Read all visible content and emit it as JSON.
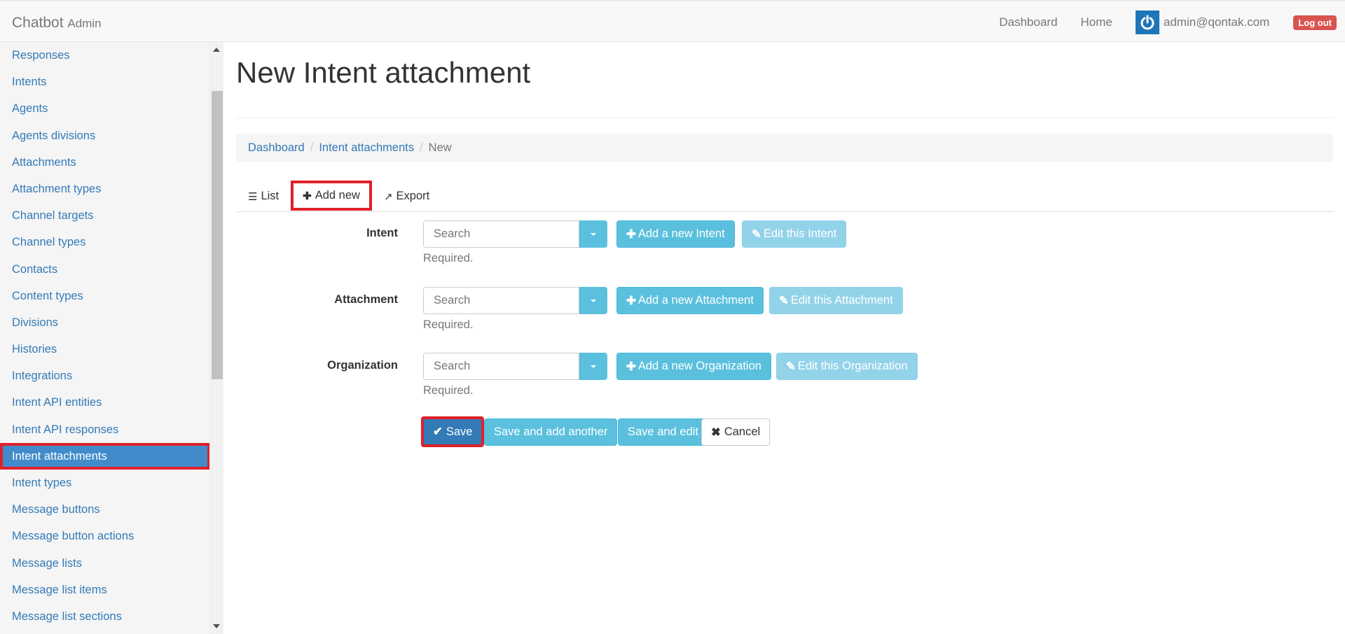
{
  "navbar": {
    "brand": "Chatbot",
    "brand_suffix": "Admin",
    "links": [
      "Dashboard",
      "Home"
    ],
    "user_email": "admin@qontak.com",
    "logout_label": "Log out"
  },
  "sidebar": {
    "items": [
      {
        "label": "Responses"
      },
      {
        "label": "Intents"
      },
      {
        "label": "Agents"
      },
      {
        "label": "Agents divisions"
      },
      {
        "label": "Attachments"
      },
      {
        "label": "Attachment types"
      },
      {
        "label": "Channel targets"
      },
      {
        "label": "Channel types"
      },
      {
        "label": "Contacts"
      },
      {
        "label": "Content types"
      },
      {
        "label": "Divisions"
      },
      {
        "label": "Histories"
      },
      {
        "label": "Integrations"
      },
      {
        "label": "Intent API entities"
      },
      {
        "label": "Intent API responses"
      },
      {
        "label": "Intent attachments"
      },
      {
        "label": "Intent types"
      },
      {
        "label": "Message buttons"
      },
      {
        "label": "Message button actions"
      },
      {
        "label": "Message lists"
      },
      {
        "label": "Message list items"
      },
      {
        "label": "Message list sections"
      }
    ],
    "active_index": 15
  },
  "page": {
    "title": "New Intent attachment",
    "breadcrumb": [
      "Dashboard",
      "Intent attachments",
      "New"
    ],
    "tabs": {
      "list": "List",
      "add_new": "Add new",
      "export": "Export"
    }
  },
  "form": {
    "fields": [
      {
        "label": "Intent",
        "placeholder": "Search",
        "help": "Required.",
        "add_label": "Add a new Intent",
        "edit_label": "Edit this Intent"
      },
      {
        "label": "Attachment",
        "placeholder": "Search",
        "help": "Required.",
        "add_label": "Add a new Attachment",
        "edit_label": "Edit this Attachment"
      },
      {
        "label": "Organization",
        "placeholder": "Search",
        "help": "Required.",
        "add_label": "Add a new Organization",
        "edit_label": "Edit this Organization"
      }
    ],
    "actions": {
      "save": "Save",
      "save_add": "Save and add another",
      "save_edit": "Save and edit",
      "cancel": "Cancel"
    }
  },
  "colors": {
    "primary": "#337ab7",
    "info": "#5bc0de",
    "danger": "#d9534f",
    "highlight": "#e0202a"
  }
}
